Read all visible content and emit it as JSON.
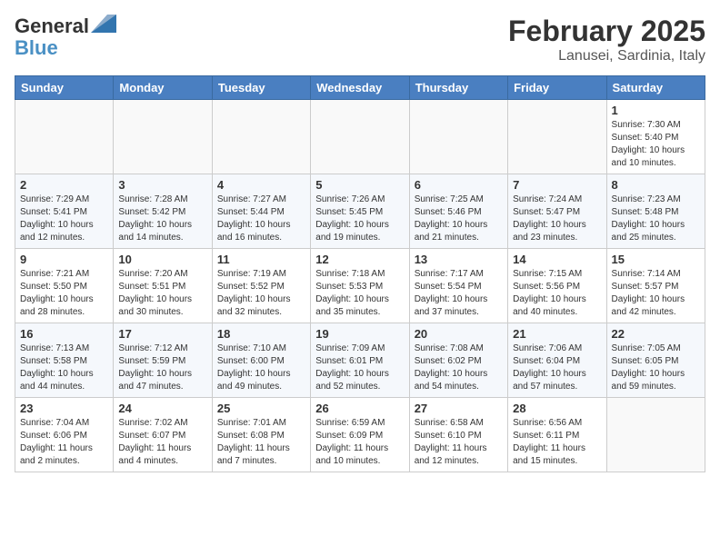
{
  "header": {
    "logo_line1": "General",
    "logo_line2": "Blue",
    "month": "February 2025",
    "location": "Lanusei, Sardinia, Italy"
  },
  "days_of_week": [
    "Sunday",
    "Monday",
    "Tuesday",
    "Wednesday",
    "Thursday",
    "Friday",
    "Saturday"
  ],
  "weeks": [
    [
      {
        "day": "",
        "info": ""
      },
      {
        "day": "",
        "info": ""
      },
      {
        "day": "",
        "info": ""
      },
      {
        "day": "",
        "info": ""
      },
      {
        "day": "",
        "info": ""
      },
      {
        "day": "",
        "info": ""
      },
      {
        "day": "1",
        "info": "Sunrise: 7:30 AM\nSunset: 5:40 PM\nDaylight: 10 hours and 10 minutes."
      }
    ],
    [
      {
        "day": "2",
        "info": "Sunrise: 7:29 AM\nSunset: 5:41 PM\nDaylight: 10 hours and 12 minutes."
      },
      {
        "day": "3",
        "info": "Sunrise: 7:28 AM\nSunset: 5:42 PM\nDaylight: 10 hours and 14 minutes."
      },
      {
        "day": "4",
        "info": "Sunrise: 7:27 AM\nSunset: 5:44 PM\nDaylight: 10 hours and 16 minutes."
      },
      {
        "day": "5",
        "info": "Sunrise: 7:26 AM\nSunset: 5:45 PM\nDaylight: 10 hours and 19 minutes."
      },
      {
        "day": "6",
        "info": "Sunrise: 7:25 AM\nSunset: 5:46 PM\nDaylight: 10 hours and 21 minutes."
      },
      {
        "day": "7",
        "info": "Sunrise: 7:24 AM\nSunset: 5:47 PM\nDaylight: 10 hours and 23 minutes."
      },
      {
        "day": "8",
        "info": "Sunrise: 7:23 AM\nSunset: 5:48 PM\nDaylight: 10 hours and 25 minutes."
      }
    ],
    [
      {
        "day": "9",
        "info": "Sunrise: 7:21 AM\nSunset: 5:50 PM\nDaylight: 10 hours and 28 minutes."
      },
      {
        "day": "10",
        "info": "Sunrise: 7:20 AM\nSunset: 5:51 PM\nDaylight: 10 hours and 30 minutes."
      },
      {
        "day": "11",
        "info": "Sunrise: 7:19 AM\nSunset: 5:52 PM\nDaylight: 10 hours and 32 minutes."
      },
      {
        "day": "12",
        "info": "Sunrise: 7:18 AM\nSunset: 5:53 PM\nDaylight: 10 hours and 35 minutes."
      },
      {
        "day": "13",
        "info": "Sunrise: 7:17 AM\nSunset: 5:54 PM\nDaylight: 10 hours and 37 minutes."
      },
      {
        "day": "14",
        "info": "Sunrise: 7:15 AM\nSunset: 5:56 PM\nDaylight: 10 hours and 40 minutes."
      },
      {
        "day": "15",
        "info": "Sunrise: 7:14 AM\nSunset: 5:57 PM\nDaylight: 10 hours and 42 minutes."
      }
    ],
    [
      {
        "day": "16",
        "info": "Sunrise: 7:13 AM\nSunset: 5:58 PM\nDaylight: 10 hours and 44 minutes."
      },
      {
        "day": "17",
        "info": "Sunrise: 7:12 AM\nSunset: 5:59 PM\nDaylight: 10 hours and 47 minutes."
      },
      {
        "day": "18",
        "info": "Sunrise: 7:10 AM\nSunset: 6:00 PM\nDaylight: 10 hours and 49 minutes."
      },
      {
        "day": "19",
        "info": "Sunrise: 7:09 AM\nSunset: 6:01 PM\nDaylight: 10 hours and 52 minutes."
      },
      {
        "day": "20",
        "info": "Sunrise: 7:08 AM\nSunset: 6:02 PM\nDaylight: 10 hours and 54 minutes."
      },
      {
        "day": "21",
        "info": "Sunrise: 7:06 AM\nSunset: 6:04 PM\nDaylight: 10 hours and 57 minutes."
      },
      {
        "day": "22",
        "info": "Sunrise: 7:05 AM\nSunset: 6:05 PM\nDaylight: 10 hours and 59 minutes."
      }
    ],
    [
      {
        "day": "23",
        "info": "Sunrise: 7:04 AM\nSunset: 6:06 PM\nDaylight: 11 hours and 2 minutes."
      },
      {
        "day": "24",
        "info": "Sunrise: 7:02 AM\nSunset: 6:07 PM\nDaylight: 11 hours and 4 minutes."
      },
      {
        "day": "25",
        "info": "Sunrise: 7:01 AM\nSunset: 6:08 PM\nDaylight: 11 hours and 7 minutes."
      },
      {
        "day": "26",
        "info": "Sunrise: 6:59 AM\nSunset: 6:09 PM\nDaylight: 11 hours and 10 minutes."
      },
      {
        "day": "27",
        "info": "Sunrise: 6:58 AM\nSunset: 6:10 PM\nDaylight: 11 hours and 12 minutes."
      },
      {
        "day": "28",
        "info": "Sunrise: 6:56 AM\nSunset: 6:11 PM\nDaylight: 11 hours and 15 minutes."
      },
      {
        "day": "",
        "info": ""
      }
    ]
  ]
}
